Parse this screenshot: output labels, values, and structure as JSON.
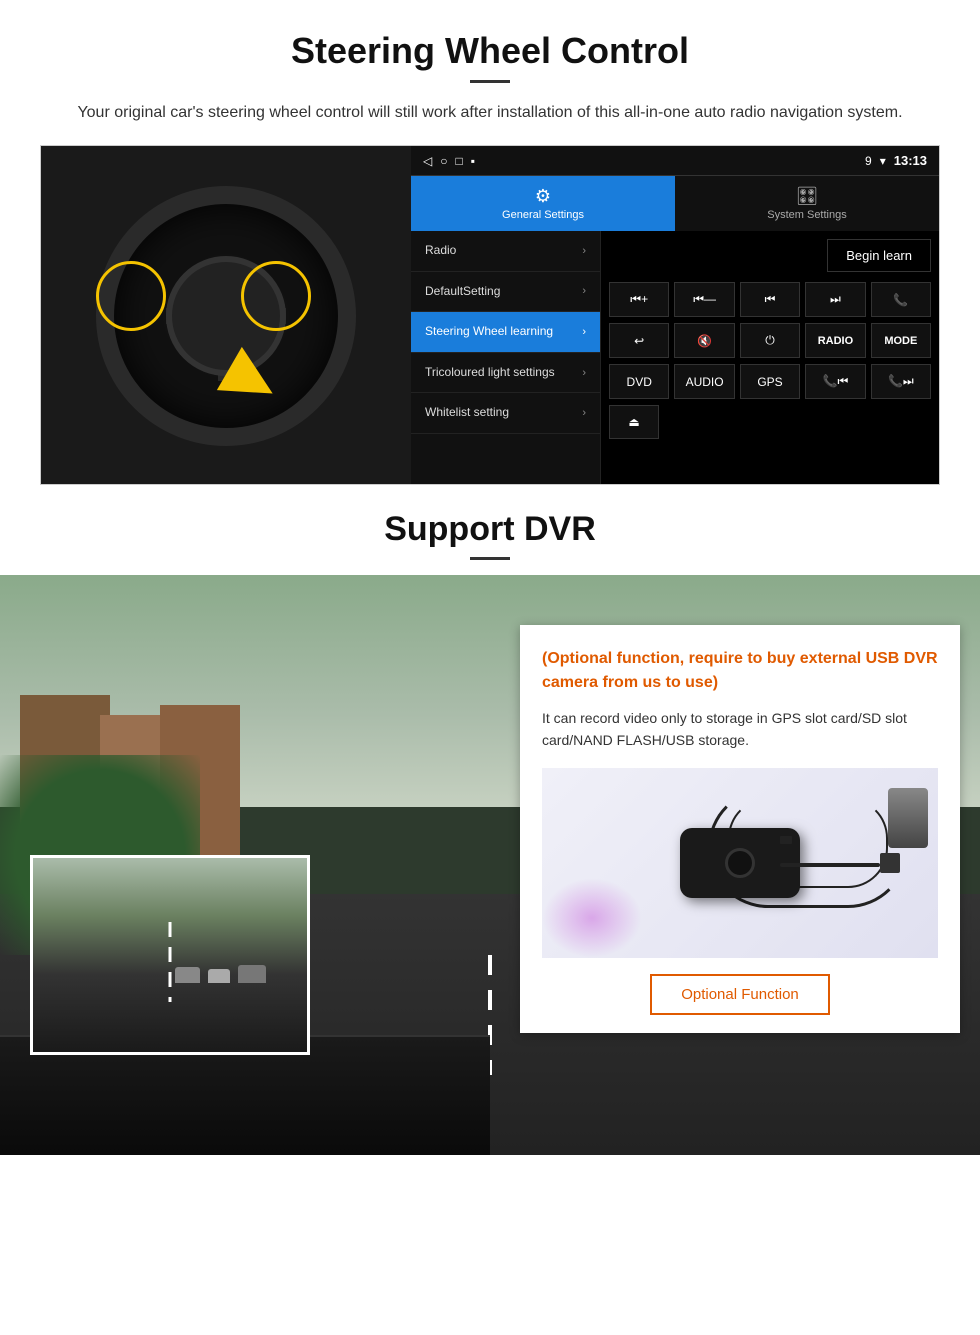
{
  "page": {
    "section1": {
      "title": "Steering Wheel Control",
      "subtitle": "Your original car's steering wheel control will still work after installation of this all-in-one auto radio navigation system.",
      "android_ui": {
        "statusbar": {
          "time": "13:13",
          "signal_icon": "▾",
          "wifi_icon": "▾",
          "battery_icon": "▪"
        },
        "tabs": [
          {
            "id": "general",
            "label": "General Settings",
            "icon": "⚙",
            "active": true
          },
          {
            "id": "system",
            "label": "System Settings",
            "icon": "🎛",
            "active": false
          }
        ],
        "menu_items": [
          {
            "label": "Radio",
            "active": false
          },
          {
            "label": "DefaultSetting",
            "active": false
          },
          {
            "label": "Steering Wheel learning",
            "active": true
          },
          {
            "label": "Tricoloured light settings",
            "active": false
          },
          {
            "label": "Whitelist setting",
            "active": false
          }
        ],
        "begin_learn_btn": "Begin learn",
        "control_buttons_row1": [
          "⏮+",
          "⏮—",
          "⏮⏮",
          "⏭⏭",
          "📞"
        ],
        "control_buttons_row2": [
          "↩",
          "🔇",
          "⏻",
          "RADIO",
          "MODE"
        ],
        "control_buttons_row3": [
          "DVD",
          "AUDIO",
          "GPS",
          "📞⏮",
          "📞⏭"
        ],
        "control_buttons_row4": [
          "⏏"
        ]
      }
    },
    "section2": {
      "title": "Support DVR",
      "optional_text": "(Optional function, require to buy external USB DVR camera from us to use)",
      "description": "It can record video only to storage in GPS slot card/SD slot card/NAND FLASH/USB storage.",
      "optional_function_btn": "Optional Function"
    }
  }
}
